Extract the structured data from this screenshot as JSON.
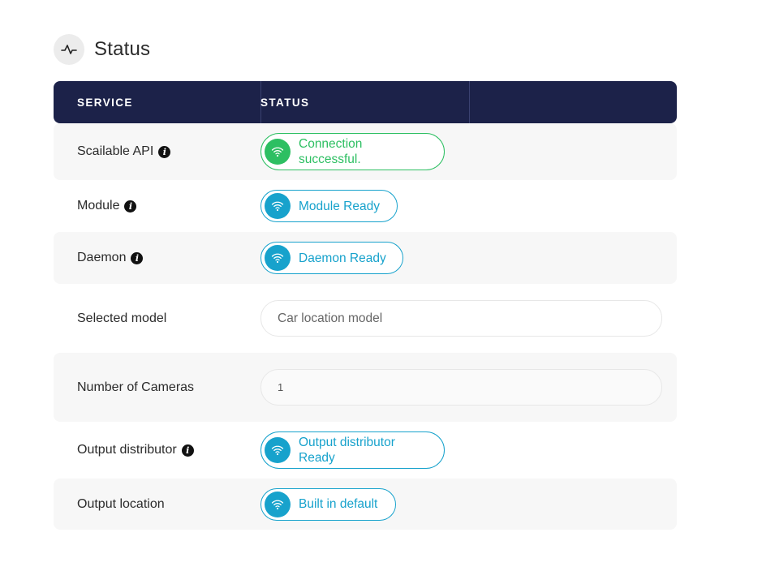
{
  "header": {
    "title": "Status",
    "icon": "activity-icon"
  },
  "table": {
    "columns": [
      "SERVICE",
      "STATUS"
    ],
    "rows": [
      {
        "label": "Scailable API",
        "info": true,
        "status": "Connection successful.",
        "status_lines": [
          "Connection",
          "successful."
        ],
        "state": "green"
      },
      {
        "label": "Module",
        "info": true,
        "status": "Module Ready",
        "state": "blue"
      },
      {
        "label": "Daemon",
        "info": true,
        "status": "Daemon Ready",
        "state": "blue"
      },
      {
        "label": "Selected model",
        "value": "Car location model"
      },
      {
        "label": "Number of Cameras",
        "value": "1"
      },
      {
        "label": "Output distributor",
        "info": true,
        "status": "Output distributor Ready",
        "status_lines": [
          "Output distributor",
          "Ready"
        ],
        "state": "blue"
      },
      {
        "label": "Output location",
        "status": "Built in default",
        "state": "blue"
      }
    ]
  },
  "colors": {
    "header_bg": "#1c2249",
    "success": "#2dbf62",
    "ready": "#17a2cc"
  }
}
